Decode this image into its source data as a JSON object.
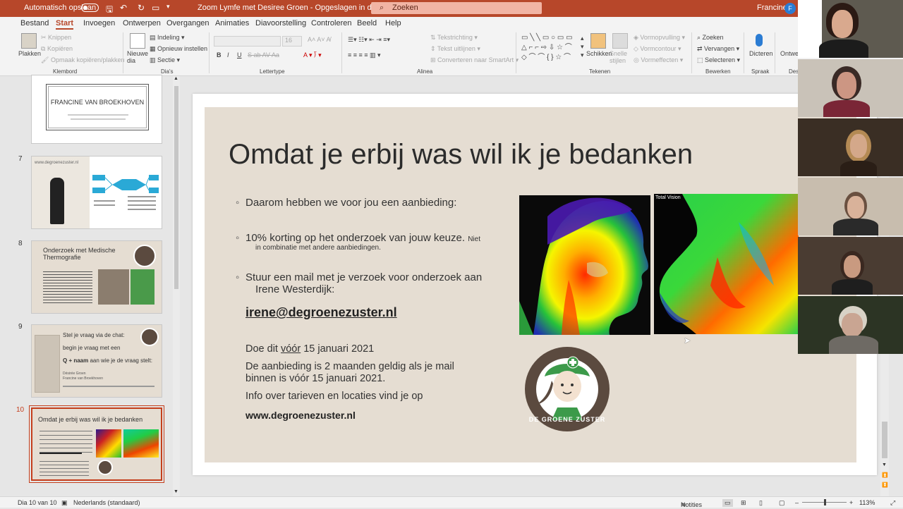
{
  "titlebar": {
    "autosave_label": "Automatisch opslaan",
    "doc_title": "Zoom Lymfe met Desiree Groen - Opgeslagen in deze pc",
    "search_placeholder": "Zoeken",
    "user_name": "Francine",
    "user_initial": "F"
  },
  "tabs": [
    "Bestand",
    "Start",
    "Invoegen",
    "Ontwerpen",
    "Overgangen",
    "Animaties",
    "Diavoorstelling",
    "Controleren",
    "Beeld",
    "Help"
  ],
  "ribbon": {
    "plakken": "Plakken",
    "knippen": "Knippen",
    "kopieren": "Kopiëren",
    "opmaak_kopieren": "Opmaak kopiëren/plakken",
    "klembord": "Klembord",
    "nieuwe_dia": "Nieuwe dia",
    "indeling": "Indeling",
    "opnieuw_instellen": "Opnieuw instellen",
    "sectie": "Sectie",
    "dias": "Dia's",
    "font_size": "16",
    "lettertype": "Lettertype",
    "tekstrichting": "Tekstrichting",
    "tekst_uitlijnen": "Tekst uitlijnen",
    "smartart": "Converteren naar SmartArt",
    "alinea": "Alinea",
    "schikken": "Schikken",
    "snelle_stijlen": "Snelle stijlen",
    "vormopvulling": "Vormopvulling",
    "vormcontour": "Vormcontour",
    "vormeffecten": "Vormeffecten",
    "tekenen": "Tekenen",
    "zoeken": "Zoeken",
    "vervangen": "Vervangen",
    "selecteren": "Selecteren",
    "bewerken": "Bewerken",
    "dicteren": "Dicteren",
    "spraak": "Spraak",
    "ontwerpen_partial": "Ontwe",
    "des_partial": "Des"
  },
  "thumbnails": [
    {
      "num": "",
      "title": "FRANCINE VAN BROEKHOVEN"
    },
    {
      "num": "7",
      "title": "www.degroenezuster.nl"
    },
    {
      "num": "8",
      "title": "Onderzoek met Medische Thermografie"
    },
    {
      "num": "9",
      "title": "Stel je vraag via de chat:",
      "line2": "begin je vraag met een",
      "line3": "Q + naam",
      "line3b": "aan wie je de vraag stelt:",
      "names": "Désirée Groen\nFrancine van Broekhoven"
    },
    {
      "num": "10",
      "title": "Omdat je erbij was wil ik je bedanken"
    }
  ],
  "slide": {
    "title": "Omdat je erbij was wil ik je bedanken",
    "bullet1": "Daarom hebben we voor jou een aanbieding:",
    "bullet2": "10% korting op het onderzoek van jouw keuze.",
    "bullet2_small_a": "Niet",
    "bullet2_small_b": "in combinatie met andere aanbiedingen.",
    "bullet3_a": "Stuur een mail met je verzoek voor onderzoek aan",
    "bullet3_b": "Irene Westerdijk:",
    "email": "irene@degroenezuster.nl",
    "doe_dit_a": "Doe dit ",
    "doe_dit_u": "vóór",
    "doe_dit_b": " 15 januari 2021",
    "geldig_a": "De aanbieding is 2 maanden geldig als je mail",
    "geldig_b": "binnen is vóór 15 januari 2021.",
    "info": "Info over tarieven en locaties vind je op",
    "website": "www.degroenezuster.nl",
    "thermo_label": "Total Vision",
    "logo_text": "DE GROENE ZUSTER"
  },
  "statusbar": {
    "slide_count": "Dia 10 van 10",
    "language": "Nederlands (standaard)",
    "notes": "Notities",
    "zoom": "113%"
  }
}
